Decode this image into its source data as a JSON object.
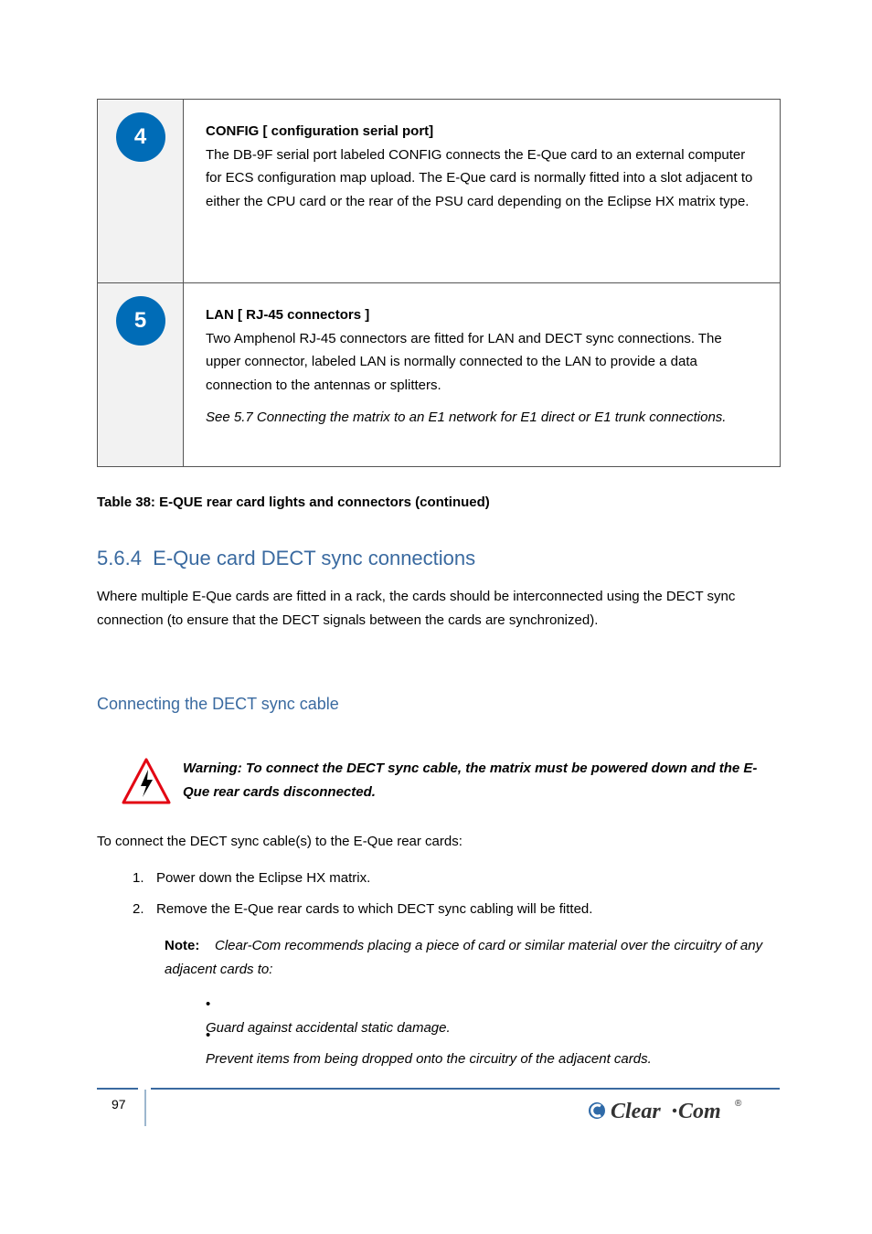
{
  "row1": {
    "num": "4",
    "title": "CONFIG [ configuration serial port]",
    "body": "The DB-9F serial port labeled CONFIG connects the E-Que card to an external computer for ECS configuration map upload. The E-Que card is normally fitted into a slot adjacent to either the CPU card or the rear of the PSU card depending on the Eclipse HX matrix type."
  },
  "row2": {
    "num": "5",
    "title": "LAN [ RJ-45 connectors ]",
    "body": "Two Amphenol RJ-45 connectors are fitted for LAN and DECT sync connections. The upper connector, labeled LAN is normally connected to the LAN to provide a data connection to the antennas or splitters.",
    "note": "See 5.7 Connecting the matrix to an E1 network for E1 direct or E1 trunk connections."
  },
  "caption": "Table 38: E-QUE rear card lights and connectors (continued)",
  "section": {
    "num": "5.6.4",
    "title": "E-Que card DECT sync connections",
    "body": "Where multiple E-Que cards are fitted in a rack, the cards should be interconnected using the DECT sync connection (to ensure that the DECT signals between the cards are synchronized)."
  },
  "sub": {
    "title": "Connecting the DECT sync cable",
    "warning": "Warning: To connect the DECT sync cable, the matrix must be powered down and the E-Que rear cards disconnected.",
    "intro": "To connect the DECT sync cable(s) to the E-Que rear cards:",
    "step1": "Power down the Eclipse HX matrix.",
    "step2": "Remove the E-Que rear cards to which DECT sync cabling will be fitted.",
    "note_lead": "Note:",
    "note_body": "Clear-Com recommends placing a piece of card or similar material over the circuitry of any adjacent cards to:",
    "bullet1": "Guard against accidental static damage.",
    "bullet2": "Prevent items from being dropped onto the circuitry of the adjacent cards."
  },
  "page_number": "97",
  "logo_text": "Clear-Com"
}
